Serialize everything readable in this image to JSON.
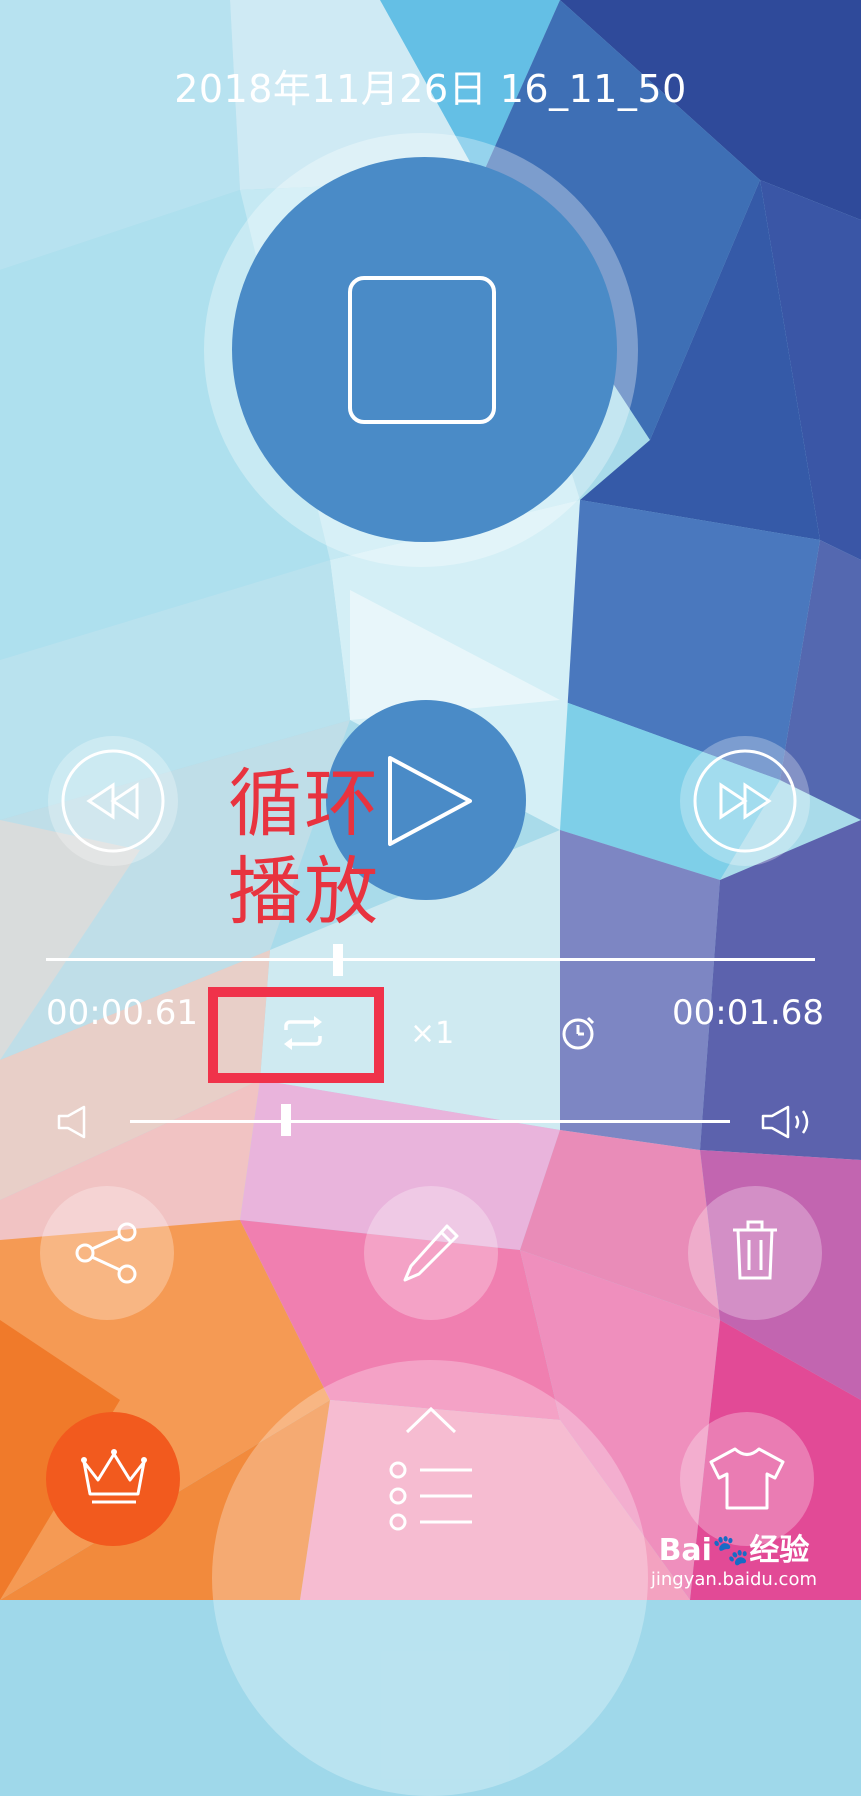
{
  "header": {
    "title": "2018年11月26日 16_11_50"
  },
  "recorder": {
    "stop_icon": "stop-square-icon"
  },
  "playback": {
    "rewind_icon": "rewind-icon",
    "play_icon": "play-icon",
    "forward_icon": "fast-forward-icon",
    "progress": 0.38,
    "elapsed": "00:00.61",
    "total": "00:01.68",
    "loop_icon": "loop-icon",
    "speed": "×1",
    "timer_icon": "timer-icon"
  },
  "volume": {
    "level": 0.26,
    "mute_icon": "speaker-low-icon",
    "max_icon": "speaker-high-icon"
  },
  "actions": {
    "share_icon": "share-icon",
    "edit_icon": "pencil-icon",
    "delete_icon": "trash-icon"
  },
  "bottom": {
    "vip_icon": "crown-icon",
    "menu_icon": "list-menu-icon",
    "expand_icon": "chevron-up-icon",
    "skin_icon": "tshirt-icon"
  },
  "annotation": {
    "line1": "循环",
    "line2": "播放"
  },
  "watermark": {
    "brand": "Bai",
    "brand_cn": "经验",
    "url": "jingyan.baidu.com"
  },
  "colors": {
    "accent_blue": "#4a8bc7",
    "highlight_red": "#f0324a",
    "vip_orange": "#f25a1e"
  }
}
